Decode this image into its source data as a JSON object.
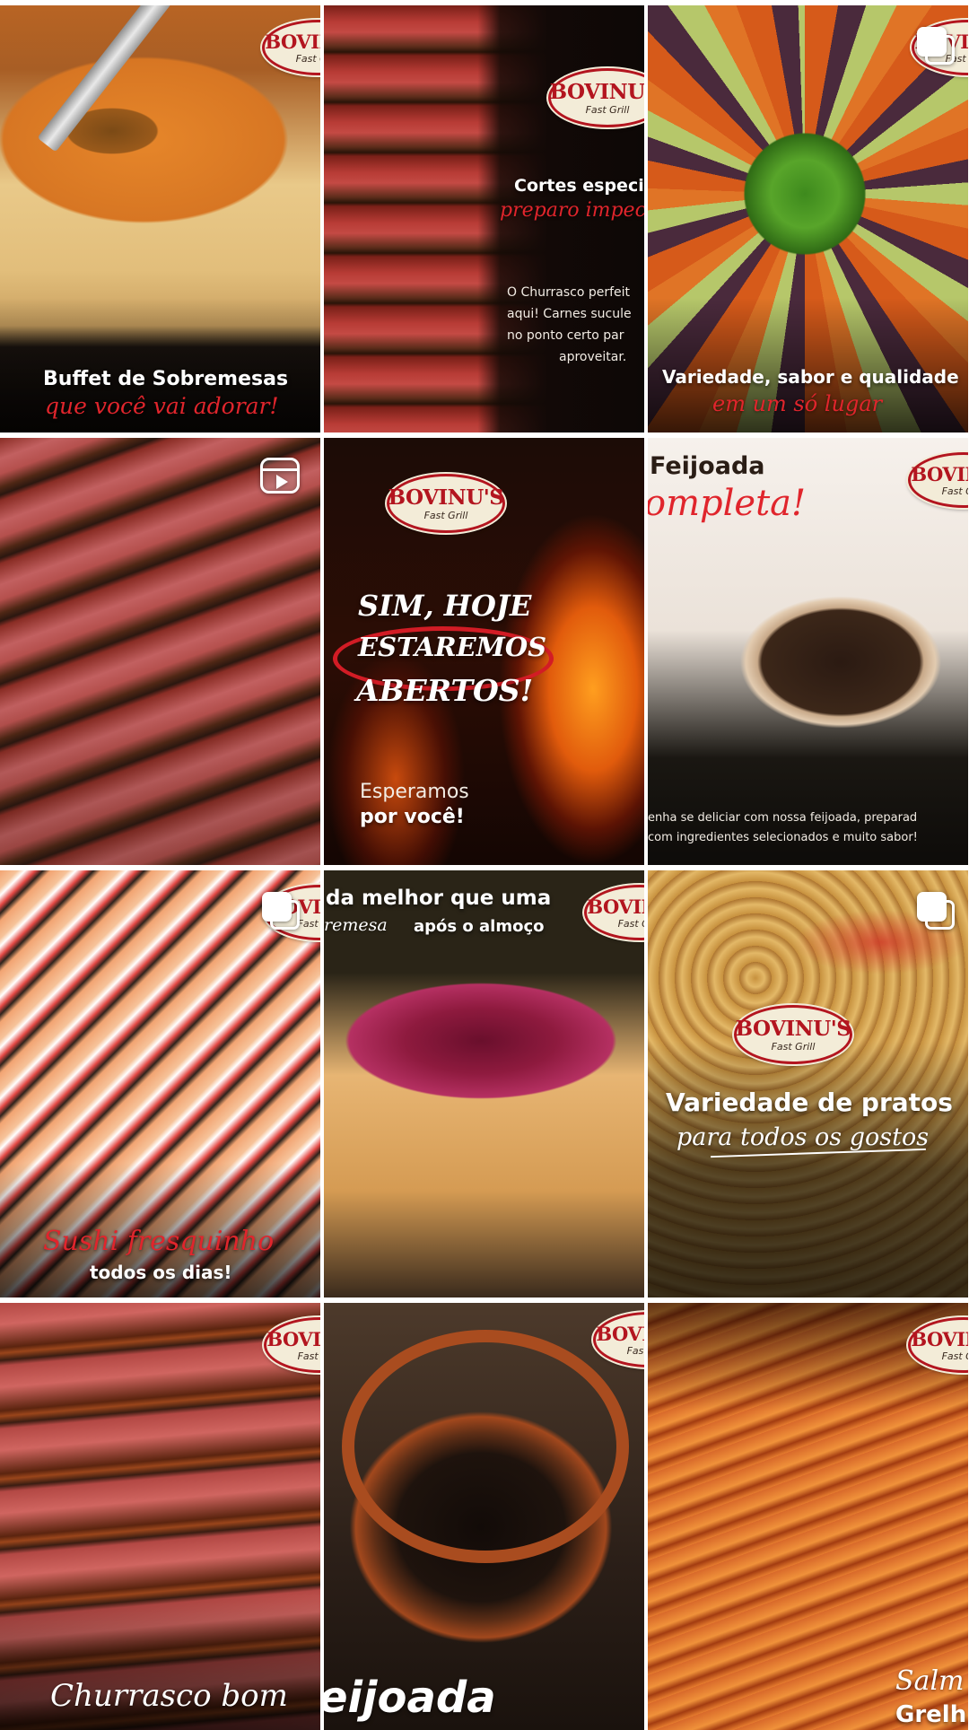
{
  "logo": {
    "brand": "BOVINU'S",
    "sub": "Fast Grill"
  },
  "colors": {
    "brand_red": "#b3151f",
    "script_red": "#e0252c",
    "badge_bg": "#f3ecd8"
  },
  "posts": [
    {
      "id": "p1",
      "title": "Buffet de Sobremesas",
      "subtitle": "que você vai adorar!",
      "icon": "none"
    },
    {
      "id": "p2",
      "title": "Cortes especi",
      "subtitle": "preparo impec",
      "body": [
        "O Churrasco perfeit",
        "aqui! Carnes sucule",
        "no ponto certo par",
        "aproveitar."
      ],
      "icon": "none"
    },
    {
      "id": "p3",
      "title": "Variedade, sabor e qualidade",
      "subtitle": "em um só lugar",
      "icon": "carousel"
    },
    {
      "id": "p4",
      "icon": "reel"
    },
    {
      "id": "p5",
      "lines": [
        "SIM, HOJE",
        "ESTAREMOS",
        "ABERTOS!"
      ],
      "footer": [
        "Esperamos",
        "por você!"
      ],
      "icon": "none"
    },
    {
      "id": "p6",
      "title": "Feijoada",
      "subtitle": "ompleta!",
      "body": [
        "enha se deliciar com nossa feijoada, preparad",
        "com ingredientes selecionados e muito sabor!"
      ],
      "icon": "none"
    },
    {
      "id": "p7",
      "subtitle": "Sushi fresquinho",
      "title": "todos os dias!",
      "icon": "carousel"
    },
    {
      "id": "p8",
      "title": "da melhor que uma",
      "subtitle": "remesa",
      "title2": "após o almoço",
      "icon": "none"
    },
    {
      "id": "p9",
      "title": "Variedade de pratos",
      "subtitle": "para todos os gostos",
      "icon": "carousel"
    },
    {
      "id": "p10",
      "subtitle": "Churrasco bom",
      "icon": "none"
    },
    {
      "id": "p11",
      "subtitle": "eijoada",
      "icon": "none"
    },
    {
      "id": "p12",
      "subtitle": "Salm",
      "subtitle2": "Grelh",
      "icon": "none"
    }
  ]
}
